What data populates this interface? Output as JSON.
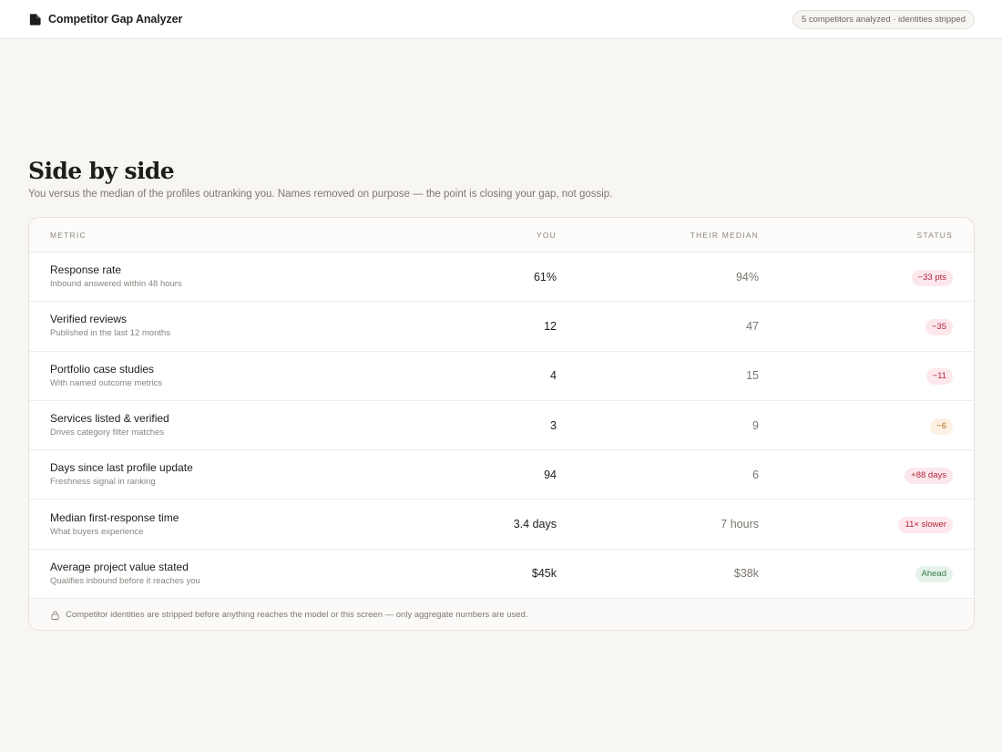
{
  "app": {
    "title": "Competitor Gap Analyzer",
    "logo_icon": "app-logo-icon"
  },
  "header": {
    "pill": "5 competitors analyzed · identities stripped"
  },
  "hero": {
    "title": "Side by side",
    "subtitle": "You versus the median of the profiles outranking you. Names removed on purpose — the point is closing your gap, not gossip."
  },
  "table": {
    "columns": {
      "metric": "METRIC",
      "you": "YOU",
      "median": "THEIR MEDIAN",
      "status": "STATUS"
    },
    "rows": [
      {
        "metric": "Response rate",
        "sub": "Inbound answered within 48 hours",
        "you": "61%",
        "median": "94%",
        "status": "−33 pts",
        "tone": "red"
      },
      {
        "metric": "Verified reviews",
        "sub": "Published in the last 12 months",
        "you": "12",
        "median": "47",
        "status": "−35",
        "tone": "red"
      },
      {
        "metric": "Portfolio case studies",
        "sub": "With named outcome metrics",
        "you": "4",
        "median": "15",
        "status": "−11",
        "tone": "red"
      },
      {
        "metric": "Services listed & verified",
        "sub": "Drives category filter matches",
        "you": "3",
        "median": "9",
        "status": "−6",
        "tone": "amber"
      },
      {
        "metric": "Days since last profile update",
        "sub": "Freshness signal in ranking",
        "you": "94",
        "median": "6",
        "status": "+88 days",
        "tone": "red"
      },
      {
        "metric": "Median first-response time",
        "sub": "What buyers experience",
        "you": "3.4 days",
        "median": "7 hours",
        "status": "11× slower",
        "tone": "red"
      },
      {
        "metric": "Average project value stated",
        "sub": "Qualifies inbound before it reaches you",
        "you": "$45k",
        "median": "$38k",
        "status": "Ahead",
        "tone": "green"
      }
    ]
  },
  "footer": {
    "icon": "lock-icon",
    "note": "Competitor identities are stripped before anything reaches the model or this screen — only aggregate numbers are used."
  },
  "colors": {
    "negative": "#b3233b",
    "warning": "#b26a1e",
    "positive": "#2f7a46",
    "background": "#f8f6f3"
  }
}
